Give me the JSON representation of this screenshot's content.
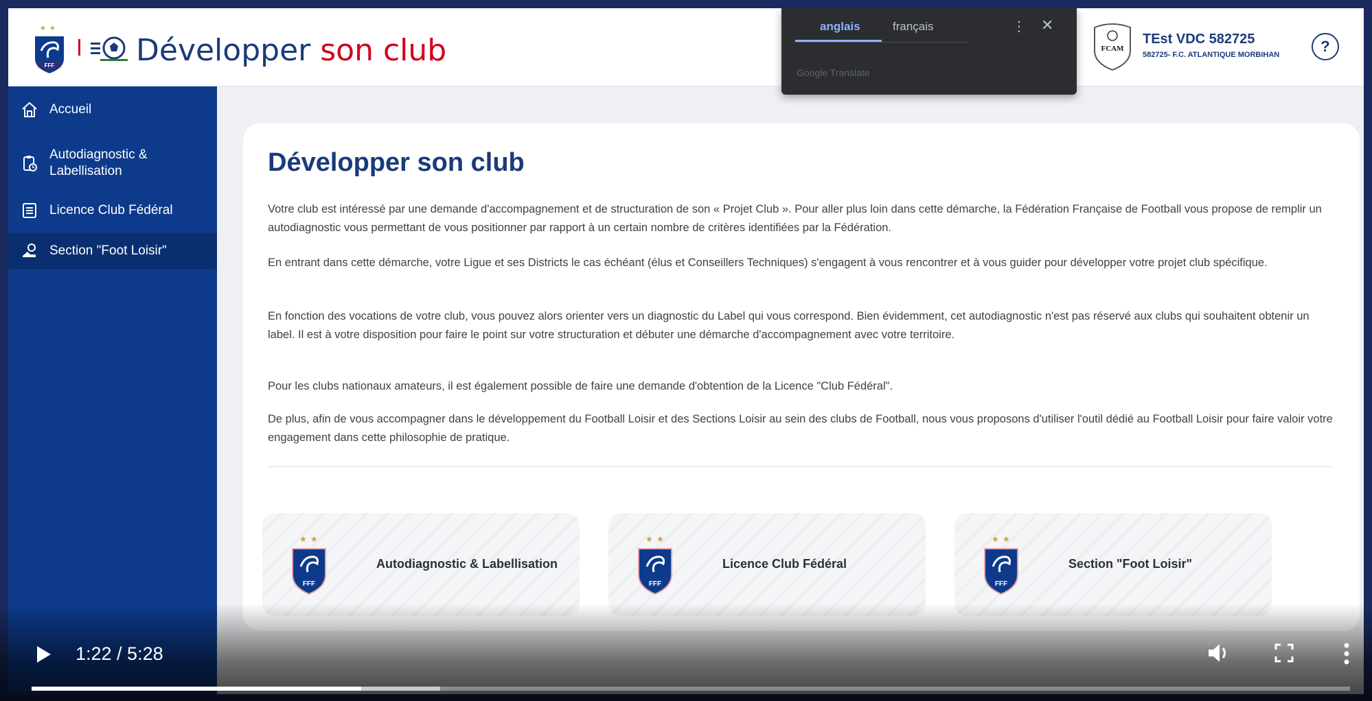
{
  "header": {
    "title_part1": "Développer",
    "title_part2": "son club",
    "club_name": "TEst VDC 582725",
    "club_sub": "582725- F.C. ATLANTIQUE MORBIHAN",
    "club_badge_text": "FCAM",
    "help_label": "?"
  },
  "translate_popup": {
    "tab_active": "anglais",
    "tab_inactive": "français",
    "brand": "Google Translate",
    "more_glyph": "⋮",
    "close_glyph": "✕"
  },
  "sidebar": {
    "items": [
      {
        "label": "Accueil",
        "icon": "home-icon"
      },
      {
        "label": "Autodiagnostic & Labellisation",
        "icon": "clipboard-icon"
      },
      {
        "label": "Licence Club Fédéral",
        "icon": "document-list-icon"
      },
      {
        "label": "Section \"Foot Loisir\"",
        "icon": "ball-shoe-icon"
      }
    ],
    "active_index": 3
  },
  "main": {
    "heading": "Développer son club",
    "paragraphs": [
      "Votre club est intéressé par une demande d'accompagnement et de structuration de son « Projet Club ». Pour aller plus loin dans cette démarche, la Fédération Française de Football vous propose de remplir un autodiagnostic vous permettant de vous positionner par rapport à un certain nombre de critères identifiées par la Fédération.",
      "En entrant dans cette démarche, votre Ligue et ses Districts le cas échéant (élus et Conseillers Techniques) s'engagent à vous rencontrer et à vous guider pour développer votre projet club spécifique.",
      "En fonction des vocations de votre club, vous pouvez alors orienter vers un diagnostic du Label qui vous correspond. Bien évidemment, cet autodiagnostic n'est pas réservé aux clubs qui souhaitent obtenir un label. Il est à votre disposition pour faire le point sur votre structuration et débuter une démarche d'accompagnement avec votre territoire.",
      "Pour les clubs nationaux amateurs, il est également possible de faire une demande d'obtention de la Licence \"Club Fédéral\".",
      "De plus, afin de vous accompagner dans le développement du Football Loisir et des Sections Loisir au sein des clubs de Football, nous vous proposons d'utiliser l'outil dédié au Football Loisir pour faire valoir votre engagement dans cette philosophie de pratique."
    ],
    "tiles": [
      {
        "label": "Autodiagnostic & Labellisation"
      },
      {
        "label": "Licence Club Fédéral"
      },
      {
        "label": "Section \"Foot Loisir\""
      }
    ],
    "fff_text": "FFF"
  },
  "video": {
    "time": "1:22 / 5:28",
    "played_fraction": 0.25,
    "buffered_fraction": 0.31
  },
  "colors": {
    "brand_blue": "#1a3a7a",
    "sidebar_blue": "#0d3a8a",
    "accent_red": "#d0021b"
  }
}
